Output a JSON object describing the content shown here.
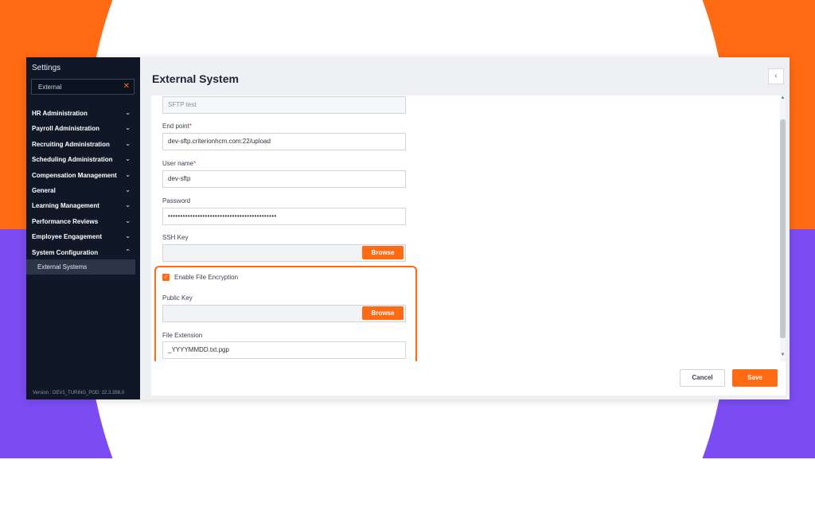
{
  "sidebar": {
    "title": "Settings",
    "search_value": "External",
    "clear_glyph": "✕",
    "items": [
      {
        "label": "HR Administration",
        "chevron": "⌄"
      },
      {
        "label": "Payroll Administration",
        "chevron": "⌄"
      },
      {
        "label": "Recruiting Administration",
        "chevron": "⌄"
      },
      {
        "label": "Scheduling Administration",
        "chevron": "⌄"
      },
      {
        "label": "Compensation Management",
        "chevron": "⌄"
      },
      {
        "label": "General",
        "chevron": "⌄"
      },
      {
        "label": "Learning Management",
        "chevron": "⌄"
      },
      {
        "label": "Performance Reviews",
        "chevron": "⌄"
      },
      {
        "label": "Employee Engagement",
        "chevron": "⌄"
      },
      {
        "label": "System Configuration",
        "chevron": "⌃"
      }
    ],
    "sub_item": "External Systems",
    "version": "Version : DEV1_TURING_POD: 22.3.398.0"
  },
  "header": {
    "title": "External System",
    "collapse_glyph": "‹"
  },
  "form": {
    "name_value": "SFTP test",
    "endpoint_label": "End point",
    "endpoint_value": "dev-sftp.criterionhcm.com:22/upload",
    "username_label": "User name",
    "username_value": "dev-sftp",
    "password_label": "Password",
    "password_value": "••••••••••••••••••••••••••••••••••••••••••••",
    "required_mark": "*",
    "ssh_key_label": "SSH Key",
    "browse_label": "Browse",
    "encryption_label": "Enable File Encryption",
    "encryption_checked": true,
    "check_glyph": "✓",
    "public_key_label": "Public Key",
    "file_extension_label": "File Extension",
    "file_extension_value": "_YYYYMMDD.txt.pgp"
  },
  "scroll": {
    "up": "▲",
    "down": "▼"
  },
  "footer": {
    "cancel_label": "Cancel",
    "save_label": "Save"
  },
  "colors": {
    "accent": "#ff6a13",
    "sidebar_bg": "#101828",
    "purple_bg": "#7b4cf2"
  }
}
